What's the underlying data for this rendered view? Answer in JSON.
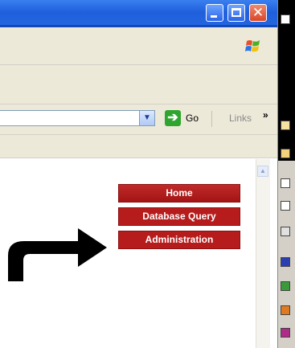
{
  "colors": {
    "titlebar": "#2466e0",
    "chrome": "#ece9d8",
    "nav_item_bg": "#b71c1c",
    "nav_item_text": "#ffffff",
    "go_green": "#2fa52f"
  },
  "icons": {
    "minimize": "minimize-icon",
    "maximize": "maximize-icon",
    "close": "close-icon",
    "windows_logo": "windows-logo-icon",
    "dropdown": "chevron-down-icon",
    "go": "arrow-right-icon",
    "links_more": "double-chevron-right-icon",
    "scroll_up": "chevron-up-icon",
    "pointer": "curved-arrow-icon"
  },
  "address_bar": {
    "go_label": "Go",
    "links_label": "Links",
    "more_label": "»"
  },
  "nav": {
    "items": [
      {
        "label": "Home"
      },
      {
        "label": "Database Query"
      },
      {
        "label": "Administration"
      }
    ]
  }
}
